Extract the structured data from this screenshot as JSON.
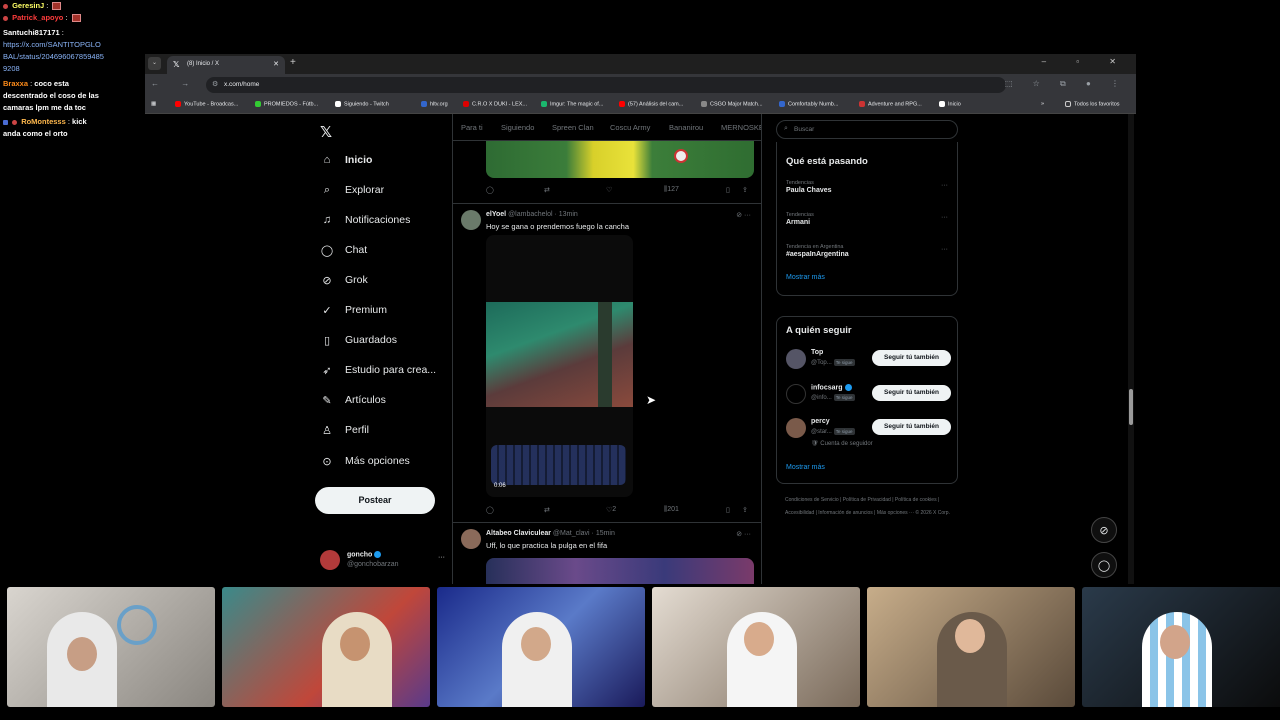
{
  "chat": {
    "lines": [
      {
        "user": "GeresinJ",
        "sep": " :",
        "text": "",
        "user_color": "#ffff66"
      },
      {
        "user": "Patrick_apoyo",
        "sep": " :",
        "text": "",
        "user_color": "#ff3c3c"
      },
      {
        "user": "Santuchi817171",
        "sep": " :",
        "text": "",
        "user_color": "#ffffff"
      },
      {
        "user": "",
        "sep": "",
        "text": "https://x.com/SANTITOPGLOBAL/status/2046960678594859208",
        "user_color": "#8ab4f8"
      },
      {
        "user": "Braxxa",
        "sep": " :",
        "text": " coco esta descentrado el coso de las camaras lpm me da toc",
        "user_color": "#ff8c1a"
      },
      {
        "user": "RoMontesss",
        "sep": " :",
        "text": " kick anda como el orto",
        "user_color": "#ffb84d"
      }
    ]
  },
  "browser": {
    "tab_title": "(8) Inicio / X",
    "url": "x.com/home",
    "bookmarks": [
      "YouTube - Broadcas...",
      "PROMIEDOS - Fútb...",
      "Siguiendo - Twitch",
      "hltv.org",
      "C.R.O X DUKI - LEX...",
      "Imgur: The magic of...",
      "(57) Análisis del cam...",
      "CSGO Major Match...",
      "Comfortably Numb...",
      "Adventure and RPG...",
      "Inicio"
    ],
    "all_bookmarks": "Todos los favoritos"
  },
  "nav": {
    "items": [
      "Inicio",
      "Explorar",
      "Notificaciones",
      "Chat",
      "Grok",
      "Premium",
      "Guardados",
      "Estudio para crea...",
      "Artículos",
      "Perfil",
      "Más opciones"
    ],
    "post_label": "Postear",
    "profile_name": "goncho",
    "profile_handle": "@gonchobarzan"
  },
  "feed": {
    "tabs": [
      "Para ti",
      "Siguiendo",
      "Spreen Clan",
      "Coscu Army",
      "Bananirou",
      "MERNOSKE"
    ],
    "tweet1_actions": {
      "views": "127"
    },
    "tweet2": {
      "name": "elYoel",
      "handle": "@lambachelol · 13min",
      "text": "Hoy se gana o prendemos fuego la cancha",
      "video_time": "0:06",
      "likes": "2",
      "views": "201"
    },
    "tweet3": {
      "name": "Altabeo Claviculear",
      "handle": "@Mat_clavi · 15min",
      "text": "Uff, lo que practica la pulga en el fifa"
    }
  },
  "right": {
    "search_placeholder": "Buscar",
    "trending_title": "Qué está pasando",
    "trends": [
      {
        "cat": "Tendencias",
        "name": "Paula Chaves"
      },
      {
        "cat": "Tendencias",
        "name": "Armani"
      },
      {
        "cat": "Tendencia en Argentina",
        "name": "#aespaInArgentina"
      }
    ],
    "show_more": "Mostrar más",
    "follow_title": "A quién seguir",
    "follow_tag": "Te sigue",
    "follow": [
      {
        "name": "Top",
        "handle": "@Top..."
      },
      {
        "name": "infocsarg",
        "handle": "@info..."
      },
      {
        "name": "percy",
        "handle": "@star..."
      }
    ],
    "follow_btn": "Seguir tú también",
    "follow_note": "Cuenta de seguidor",
    "footer": "Condiciones de Servicio | Política de Privacidad | Política de cookies | Accesibilidad | Información de anuncios | Más opciones ··· © 2026 X Corp."
  }
}
